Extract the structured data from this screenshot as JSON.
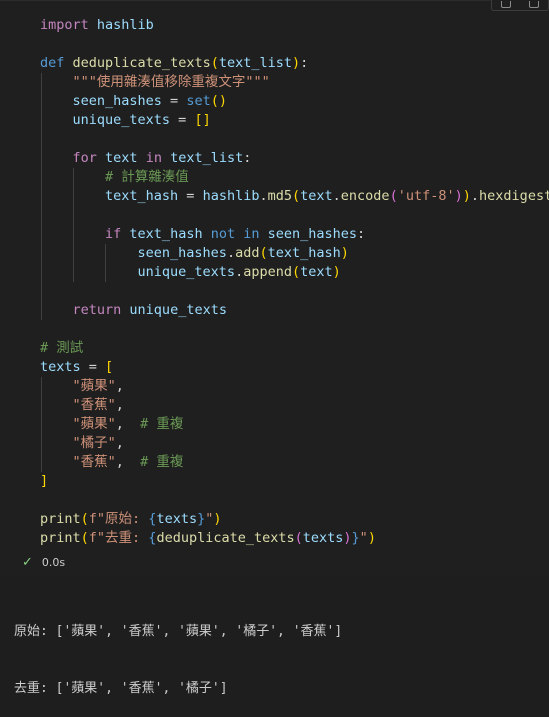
{
  "cell": {
    "lines": [
      [
        {
          "t": "import",
          "c": "kwc"
        },
        {
          "t": " hashlib",
          "c": "var"
        }
      ],
      [],
      [
        {
          "t": "def",
          "c": "kw"
        },
        {
          "t": " ",
          "c": "op"
        },
        {
          "t": "deduplicate_texts",
          "c": "fn"
        },
        {
          "t": "(",
          "c": "br1"
        },
        {
          "t": "text_list",
          "c": "var"
        },
        {
          "t": ")",
          "c": "br1"
        },
        {
          "t": ":",
          "c": "op"
        }
      ],
      [
        {
          "t": "    ",
          "c": "op"
        },
        {
          "t": "\"\"\"使用雜湊值移除重複文字\"\"\"",
          "c": "str"
        }
      ],
      [
        {
          "t": "    seen_hashes",
          "c": "var"
        },
        {
          "t": " = ",
          "c": "op"
        },
        {
          "t": "set",
          "c": "kw"
        },
        {
          "t": "()",
          "c": "br1"
        }
      ],
      [
        {
          "t": "    unique_texts",
          "c": "var"
        },
        {
          "t": " = ",
          "c": "op"
        },
        {
          "t": "[]",
          "c": "br1"
        }
      ],
      [],
      [
        {
          "t": "    ",
          "c": "op"
        },
        {
          "t": "for",
          "c": "kwc"
        },
        {
          "t": " text ",
          "c": "var"
        },
        {
          "t": "in",
          "c": "kwc"
        },
        {
          "t": " text_list",
          "c": "var"
        },
        {
          "t": ":",
          "c": "op"
        }
      ],
      [
        {
          "t": "        ",
          "c": "op"
        },
        {
          "t": "# 計算雜湊值",
          "c": "com"
        }
      ],
      [
        {
          "t": "        text_hash",
          "c": "var"
        },
        {
          "t": " = ",
          "c": "op"
        },
        {
          "t": "hashlib",
          "c": "var"
        },
        {
          "t": ".",
          "c": "op"
        },
        {
          "t": "md5",
          "c": "fn"
        },
        {
          "t": "(",
          "c": "br1"
        },
        {
          "t": "text",
          "c": "var"
        },
        {
          "t": ".",
          "c": "op"
        },
        {
          "t": "encode",
          "c": "fn"
        },
        {
          "t": "(",
          "c": "br2"
        },
        {
          "t": "'utf-8'",
          "c": "str"
        },
        {
          "t": ")",
          "c": "br2"
        },
        {
          "t": ")",
          "c": "br1"
        },
        {
          "t": ".",
          "c": "op"
        },
        {
          "t": "hexdigest",
          "c": "fn"
        },
        {
          "t": "()",
          "c": "br1"
        }
      ],
      [],
      [
        {
          "t": "        ",
          "c": "op"
        },
        {
          "t": "if",
          "c": "kwc"
        },
        {
          "t": " text_hash ",
          "c": "var"
        },
        {
          "t": "not",
          "c": "kw"
        },
        {
          "t": " ",
          "c": "op"
        },
        {
          "t": "in",
          "c": "kw"
        },
        {
          "t": " seen_hashes",
          "c": "var"
        },
        {
          "t": ":",
          "c": "op"
        }
      ],
      [
        {
          "t": "            seen_hashes",
          "c": "var"
        },
        {
          "t": ".",
          "c": "op"
        },
        {
          "t": "add",
          "c": "fn"
        },
        {
          "t": "(",
          "c": "br1"
        },
        {
          "t": "text_hash",
          "c": "var"
        },
        {
          "t": ")",
          "c": "br1"
        }
      ],
      [
        {
          "t": "            unique_texts",
          "c": "var"
        },
        {
          "t": ".",
          "c": "op"
        },
        {
          "t": "append",
          "c": "fn"
        },
        {
          "t": "(",
          "c": "br1"
        },
        {
          "t": "text",
          "c": "var"
        },
        {
          "t": ")",
          "c": "br1"
        }
      ],
      [],
      [
        {
          "t": "    ",
          "c": "op"
        },
        {
          "t": "return",
          "c": "kwc"
        },
        {
          "t": " unique_texts",
          "c": "var"
        }
      ],
      [],
      [
        {
          "t": "# 測試",
          "c": "com"
        }
      ],
      [
        {
          "t": "texts",
          "c": "var"
        },
        {
          "t": " = ",
          "c": "op"
        },
        {
          "t": "[",
          "c": "br1"
        }
      ],
      [
        {
          "t": "    ",
          "c": "op"
        },
        {
          "t": "\"蘋果\"",
          "c": "str"
        },
        {
          "t": ",",
          "c": "op"
        }
      ],
      [
        {
          "t": "    ",
          "c": "op"
        },
        {
          "t": "\"香蕉\"",
          "c": "str"
        },
        {
          "t": ",",
          "c": "op"
        }
      ],
      [
        {
          "t": "    ",
          "c": "op"
        },
        {
          "t": "\"蘋果\"",
          "c": "str"
        },
        {
          "t": ",  ",
          "c": "op"
        },
        {
          "t": "# 重複",
          "c": "com"
        }
      ],
      [
        {
          "t": "    ",
          "c": "op"
        },
        {
          "t": "\"橘子\"",
          "c": "str"
        },
        {
          "t": ",",
          "c": "op"
        }
      ],
      [
        {
          "t": "    ",
          "c": "op"
        },
        {
          "t": "\"香蕉\"",
          "c": "str"
        },
        {
          "t": ",  ",
          "c": "op"
        },
        {
          "t": "# 重複",
          "c": "com"
        }
      ],
      [
        {
          "t": "]",
          "c": "br1"
        }
      ],
      [],
      [
        {
          "t": "print",
          "c": "fn"
        },
        {
          "t": "(",
          "c": "br1"
        },
        {
          "t": "f\"原始: ",
          "c": "str"
        },
        {
          "t": "{",
          "c": "kw"
        },
        {
          "t": "texts",
          "c": "var"
        },
        {
          "t": "}",
          "c": "kw"
        },
        {
          "t": "\"",
          "c": "str"
        },
        {
          "t": ")",
          "c": "br1"
        }
      ],
      [
        {
          "t": "print",
          "c": "fn"
        },
        {
          "t": "(",
          "c": "br1"
        },
        {
          "t": "f\"去重: ",
          "c": "str"
        },
        {
          "t": "{",
          "c": "kw"
        },
        {
          "t": "deduplicate_texts",
          "c": "fn"
        },
        {
          "t": "(",
          "c": "br2"
        },
        {
          "t": "texts",
          "c": "var"
        },
        {
          "t": ")",
          "c": "br2"
        },
        {
          "t": "}",
          "c": "kw"
        },
        {
          "t": "\"",
          "c": "str"
        },
        {
          "t": ")",
          "c": "br1"
        }
      ]
    ]
  },
  "status": {
    "check_icon": "check-icon",
    "duration": "0.0s"
  },
  "output": {
    "lines": [
      "原始: ['蘋果', '香蕉', '蘋果', '橘子', '香蕉']",
      "去重: ['蘋果', '香蕉', '橘子']"
    ]
  },
  "colors": {
    "background": "#1f1f1f",
    "keyword": "#569cd6",
    "control": "#c586c0",
    "function": "#dcdcaa",
    "variable": "#9cdcfe",
    "string": "#ce9178",
    "comment": "#6a9955",
    "success": "#89d185"
  }
}
